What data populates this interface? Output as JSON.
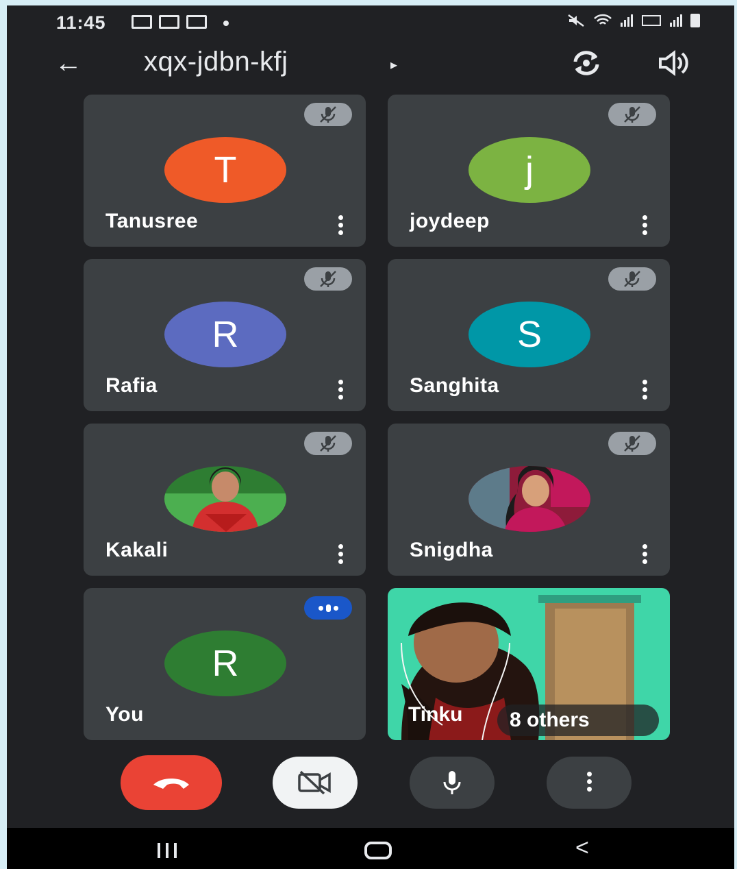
{
  "status_bar": {
    "time": "11:45"
  },
  "app_bar": {
    "title": "xqx-jdbn-kfj"
  },
  "participants": [
    {
      "name": "Tanusree",
      "initial": "T",
      "avatar_color": "#ef5a28",
      "muted": true
    },
    {
      "name": "joydeep",
      "initial": "j",
      "avatar_color": "#7cb342",
      "muted": true
    },
    {
      "name": "Rafia",
      "initial": "R",
      "avatar_color": "#5c6bc0",
      "muted": true
    },
    {
      "name": "Sanghita",
      "initial": "S",
      "avatar_color": "#0097a7",
      "muted": true
    },
    {
      "name": "Kakali",
      "avatar_type": "photo",
      "muted": true
    },
    {
      "name": "Snigdha",
      "avatar_type": "photo",
      "muted": true
    },
    {
      "name": "You",
      "initial": "R",
      "avatar_color": "#2e7d32",
      "speaking": true
    }
  ],
  "video_tile": {
    "name": "Tinku",
    "others_label": "8 others"
  },
  "controls": {
    "end_call": "end-call",
    "camera": "camera-off",
    "mic": "mic",
    "more": "more-options"
  },
  "colors": {
    "background": "#202124",
    "tile": "#3c4043",
    "end_call": "#ea4335",
    "speaking": "#1a57c9"
  }
}
